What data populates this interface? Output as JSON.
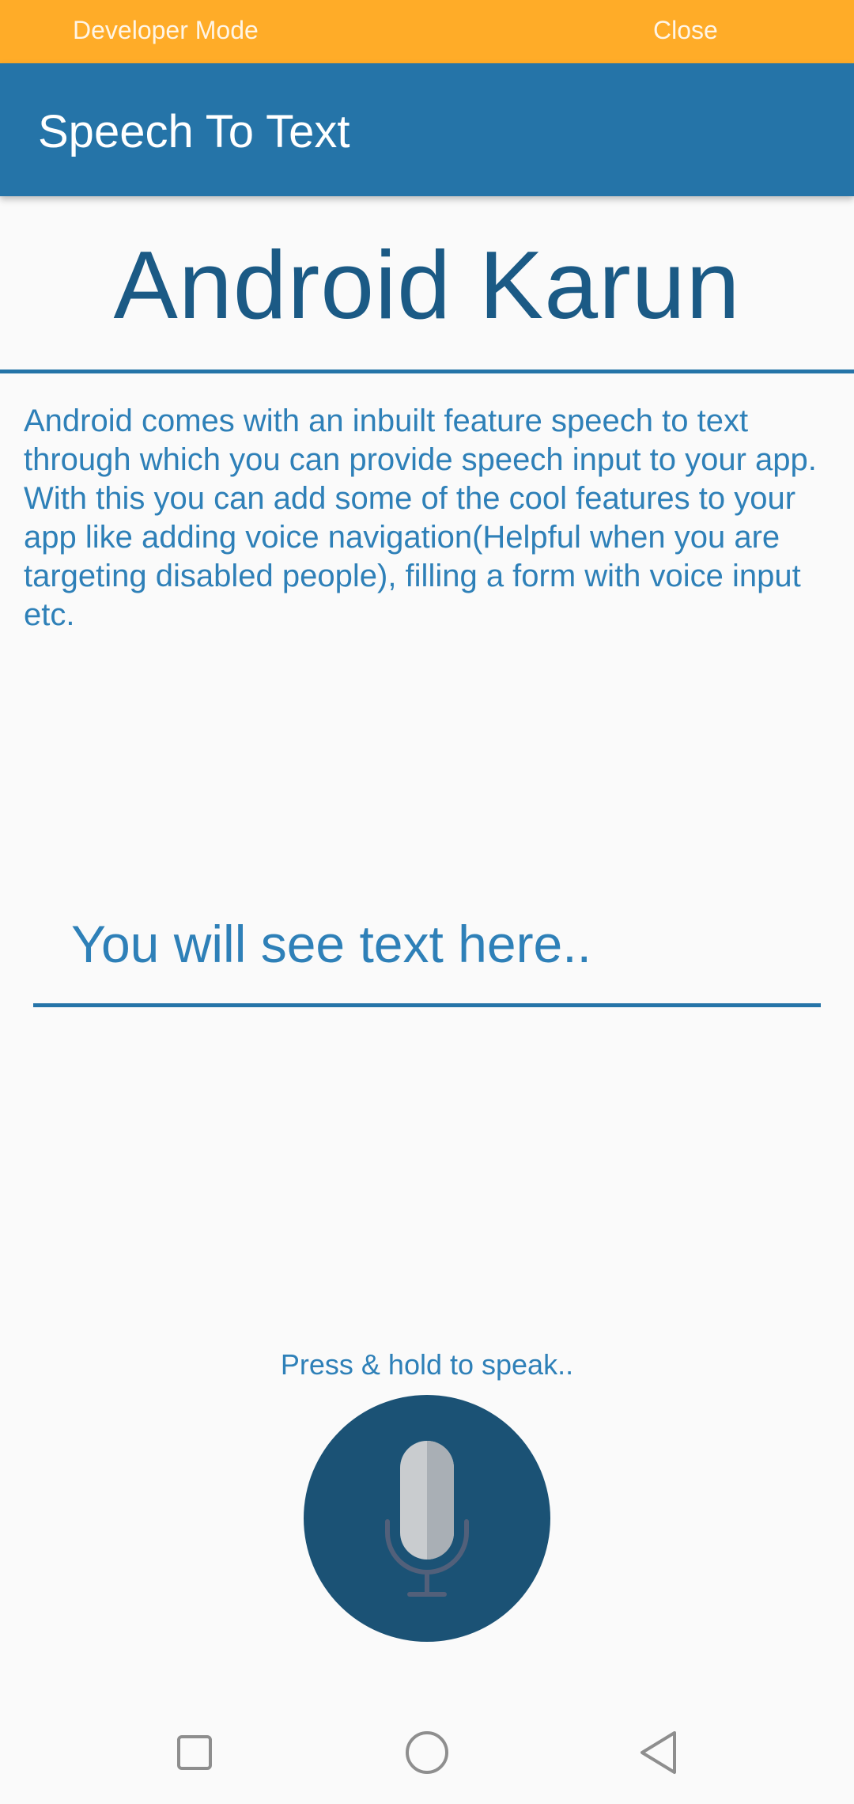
{
  "dev_bar": {
    "label": "Developer Mode",
    "close_label": "Close",
    "color": "#ffac28"
  },
  "app_bar": {
    "title": "Speech To Text",
    "color": "#2574a8"
  },
  "content": {
    "headline": "Android Karun",
    "description": "Android comes with an inbuilt feature speech to text through which you can provide speech input to your app. With this you can add some of the cool features to your app like adding voice navigation(Helpful when you are targeting disabled people), filling a form with voice input etc.",
    "output_text": "You will see text here..",
    "hint": "Press & hold to speak..",
    "mic_icon": "microphone-icon",
    "mic_button_color": "#1b5275"
  },
  "nav": {
    "recents_icon": "square-icon",
    "home_icon": "circle-icon",
    "back_icon": "triangle-back-icon"
  }
}
